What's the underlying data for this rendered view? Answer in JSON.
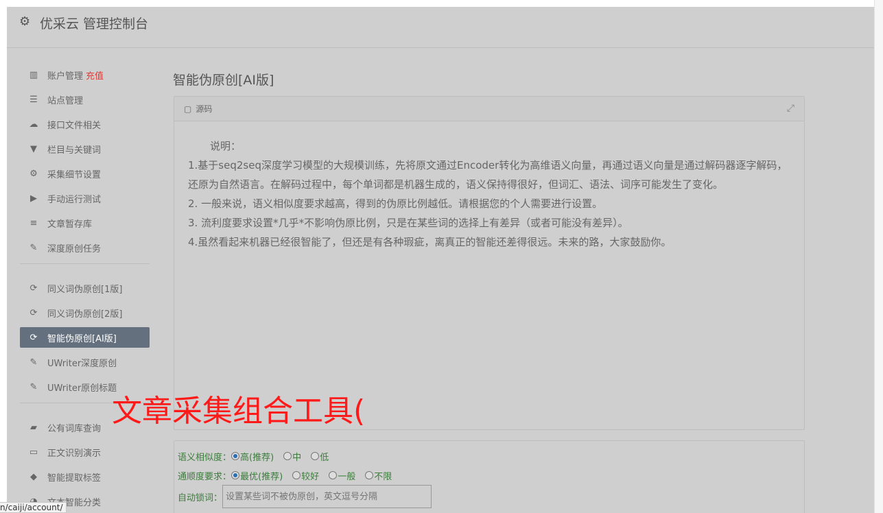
{
  "header": {
    "title": "优采云 管理控制台"
  },
  "sidebar": {
    "items": [
      {
        "icon": "bar-chart-icon",
        "label": "账户管理",
        "extra": "充值"
      },
      {
        "icon": "server-icon",
        "label": "站点管理"
      },
      {
        "icon": "cloud-upload-icon",
        "label": "接口文件相关"
      },
      {
        "icon": "filter-icon",
        "label": "栏目与关键词"
      },
      {
        "icon": "cogs-icon",
        "label": "采集细节设置"
      },
      {
        "icon": "play-circle-icon",
        "label": "手动运行测试"
      },
      {
        "icon": "database-icon",
        "label": "文章暂存库"
      },
      {
        "icon": "edit-icon",
        "label": "深度原创任务"
      },
      {
        "icon": "refresh-icon",
        "label": "同义词伪原创[1版]"
      },
      {
        "icon": "refresh-icon",
        "label": "同义词伪原创[2版]"
      },
      {
        "icon": "refresh-icon",
        "label": "智能伪原创[AI版]"
      },
      {
        "icon": "edit-icon",
        "label": "UWriter深度原创"
      },
      {
        "icon": "edit-icon",
        "label": "UWriter原创标题"
      },
      {
        "icon": "book-icon",
        "label": "公有词库查询"
      },
      {
        "icon": "desktop-icon",
        "label": "正文识别演示"
      },
      {
        "icon": "tag-icon",
        "label": "智能提取标签"
      },
      {
        "icon": "pie-chart-icon",
        "label": "文本智能分类"
      }
    ]
  },
  "main": {
    "title": "智能伪原创[AI版]",
    "panel": {
      "header": "源码",
      "intro": "说明：",
      "lines": [
        "1.基于seq2seq深度学习模型的大规模训练，先将原文通过Encoder转化为高维语义向量，再通过语义向量是通过解码器逐字解码，还原为自然语言。在解码过程中，每个单词都是机器生成的，语义保持得很好，但词汇、语法、词序可能发生了变化。",
        "2. 一般来说，语义相似度要求越高，得到的伪原比例越低。请根据您的个人需要进行设置。",
        "3. 流利度要求设置*几乎*不影响伪原比例，只是在某些词的选择上有差异（或者可能没有差异）。",
        "4.虽然看起来机器已经很智能了，但还是有各种瑕疵，离真正的智能还差得很远。未来的路，大家鼓励你。"
      ]
    },
    "options": {
      "similarity": {
        "label": "语义相似度：",
        "choices": [
          "高(推荐)",
          "中",
          "低"
        ],
        "selected": "高(推荐)"
      },
      "fluency": {
        "label": "通顺度要求：",
        "choices": [
          "最优(推荐)",
          "较好",
          "一般",
          "不限"
        ],
        "selected": "最优(推荐)"
      },
      "autolock": {
        "label": "自动锁词：",
        "placeholder": "设置某些词不被伪原创，英文逗号分隔"
      }
    }
  },
  "overlay": {
    "text": "文章采集组合工具("
  },
  "status": {
    "url": "n/caiji/account/"
  }
}
